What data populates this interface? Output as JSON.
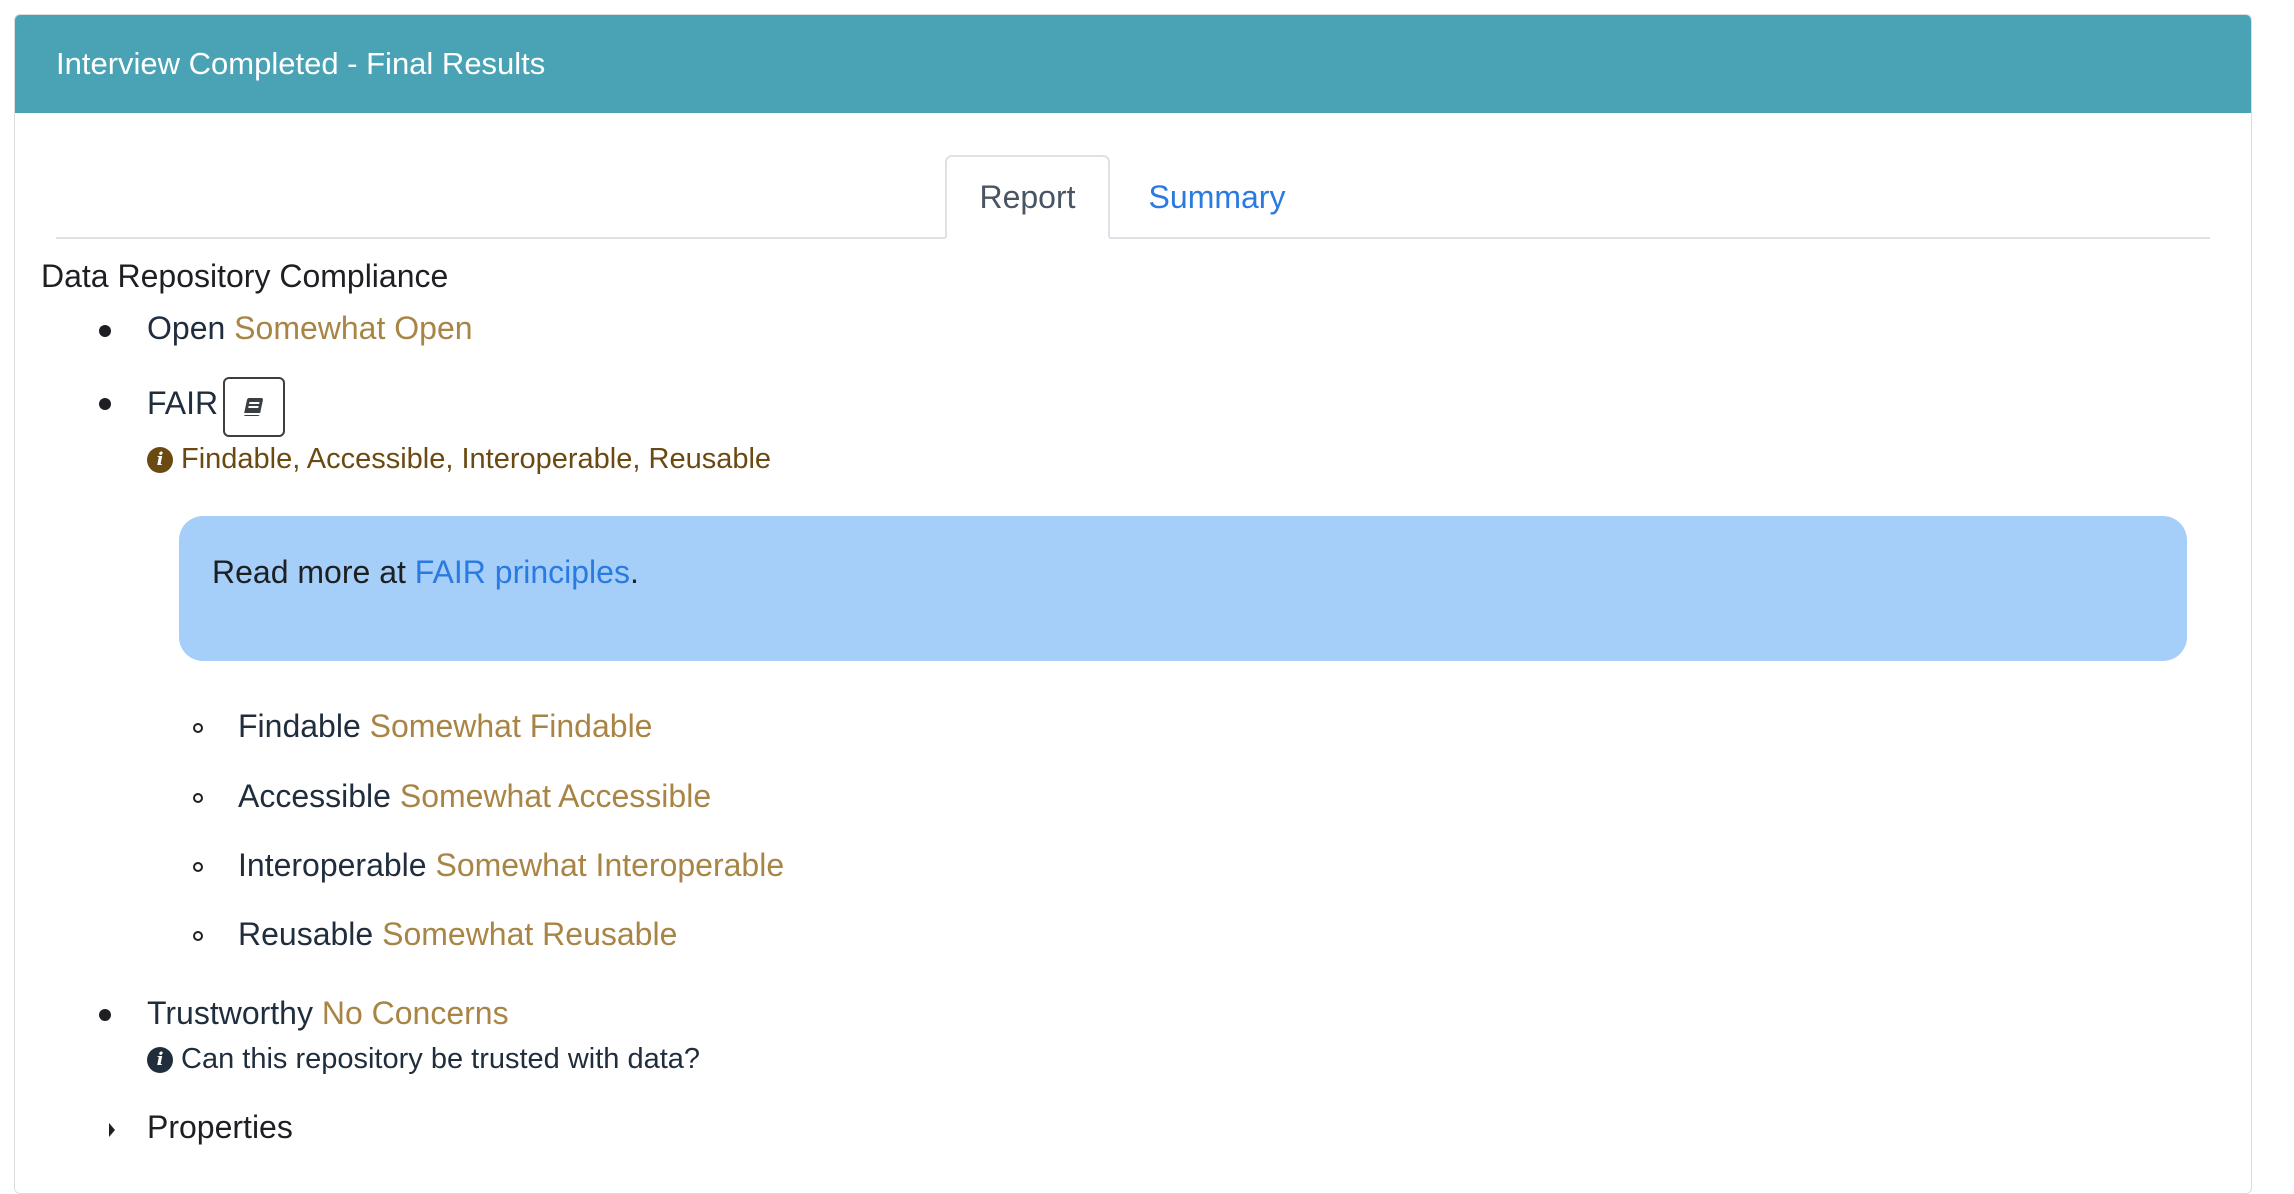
{
  "header": {
    "title": "Interview Completed - Final Results"
  },
  "tabs": [
    {
      "label": "Report",
      "active": true
    },
    {
      "label": "Summary",
      "active": false
    }
  ],
  "section": {
    "title": "Data Repository Compliance",
    "items": {
      "open": {
        "label": "Open",
        "value": "Somewhat Open"
      },
      "fair": {
        "label": "FAIR",
        "button_icon": "book-icon",
        "info": "Findable, Accessible, Interoperable, Reusable",
        "callout": {
          "prefix": "Read more at ",
          "link": "FAIR principles",
          "suffix": "."
        },
        "subitems": [
          {
            "label": "Findable",
            "value": "Somewhat Findable"
          },
          {
            "label": "Accessible",
            "value": "Somewhat Accessible"
          },
          {
            "label": "Interoperable",
            "value": "Somewhat Interoperable"
          },
          {
            "label": "Reusable",
            "value": "Somewhat Reusable"
          }
        ]
      },
      "trustworthy": {
        "label": "Trustworthy",
        "value": "No Concerns",
        "info": "Can this repository be trusted with data?"
      },
      "properties": {
        "label": "Properties"
      }
    }
  },
  "colors": {
    "header_bg": "#4aa3b5",
    "value_text": "#a98545",
    "link": "#2a7ae2",
    "callout_bg": "#a5cff8",
    "info_text": "#6b4a12"
  }
}
